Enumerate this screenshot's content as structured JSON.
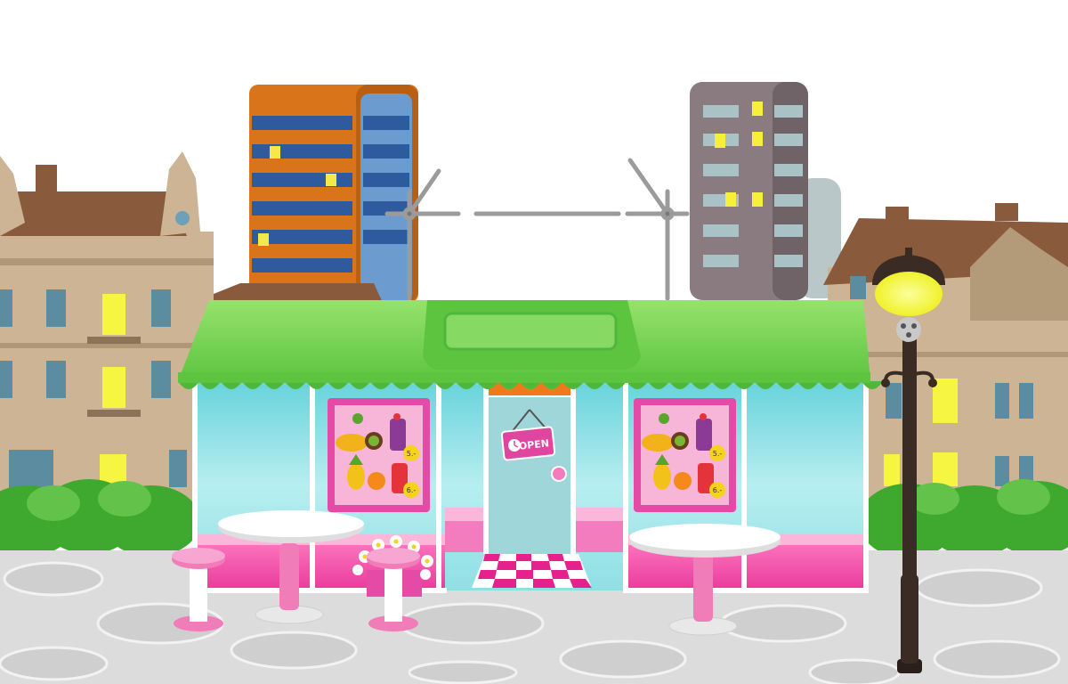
{
  "scene": {
    "title": "",
    "shop": {
      "door_sign": "OPEN",
      "poster_prices": [
        "5.-",
        "6.-"
      ]
    },
    "colors": {
      "sky": "#ffffff",
      "awning": "#7ed957",
      "awning_dark": "#4fb83a",
      "window_glass": "#9fe3e6",
      "shop_pink": "#ee4aa8",
      "shop_pink_light": "#f9a6d2",
      "pavement": "#dcdcdc",
      "lamp_light": "#f4f43a",
      "tower_orange": "#e07a1c",
      "tower_blue": "#2f5fa3",
      "tower_grey": "#8a7a80",
      "house_beige": "#cdb494",
      "roof_brown": "#8a5a3c",
      "bush_green": "#3fa82e"
    },
    "icons": [
      "street-lamp-icon",
      "open-sign-icon",
      "clock-icon",
      "fruit-poster-icon",
      "flower-pot-icon",
      "crane-icon"
    ]
  }
}
